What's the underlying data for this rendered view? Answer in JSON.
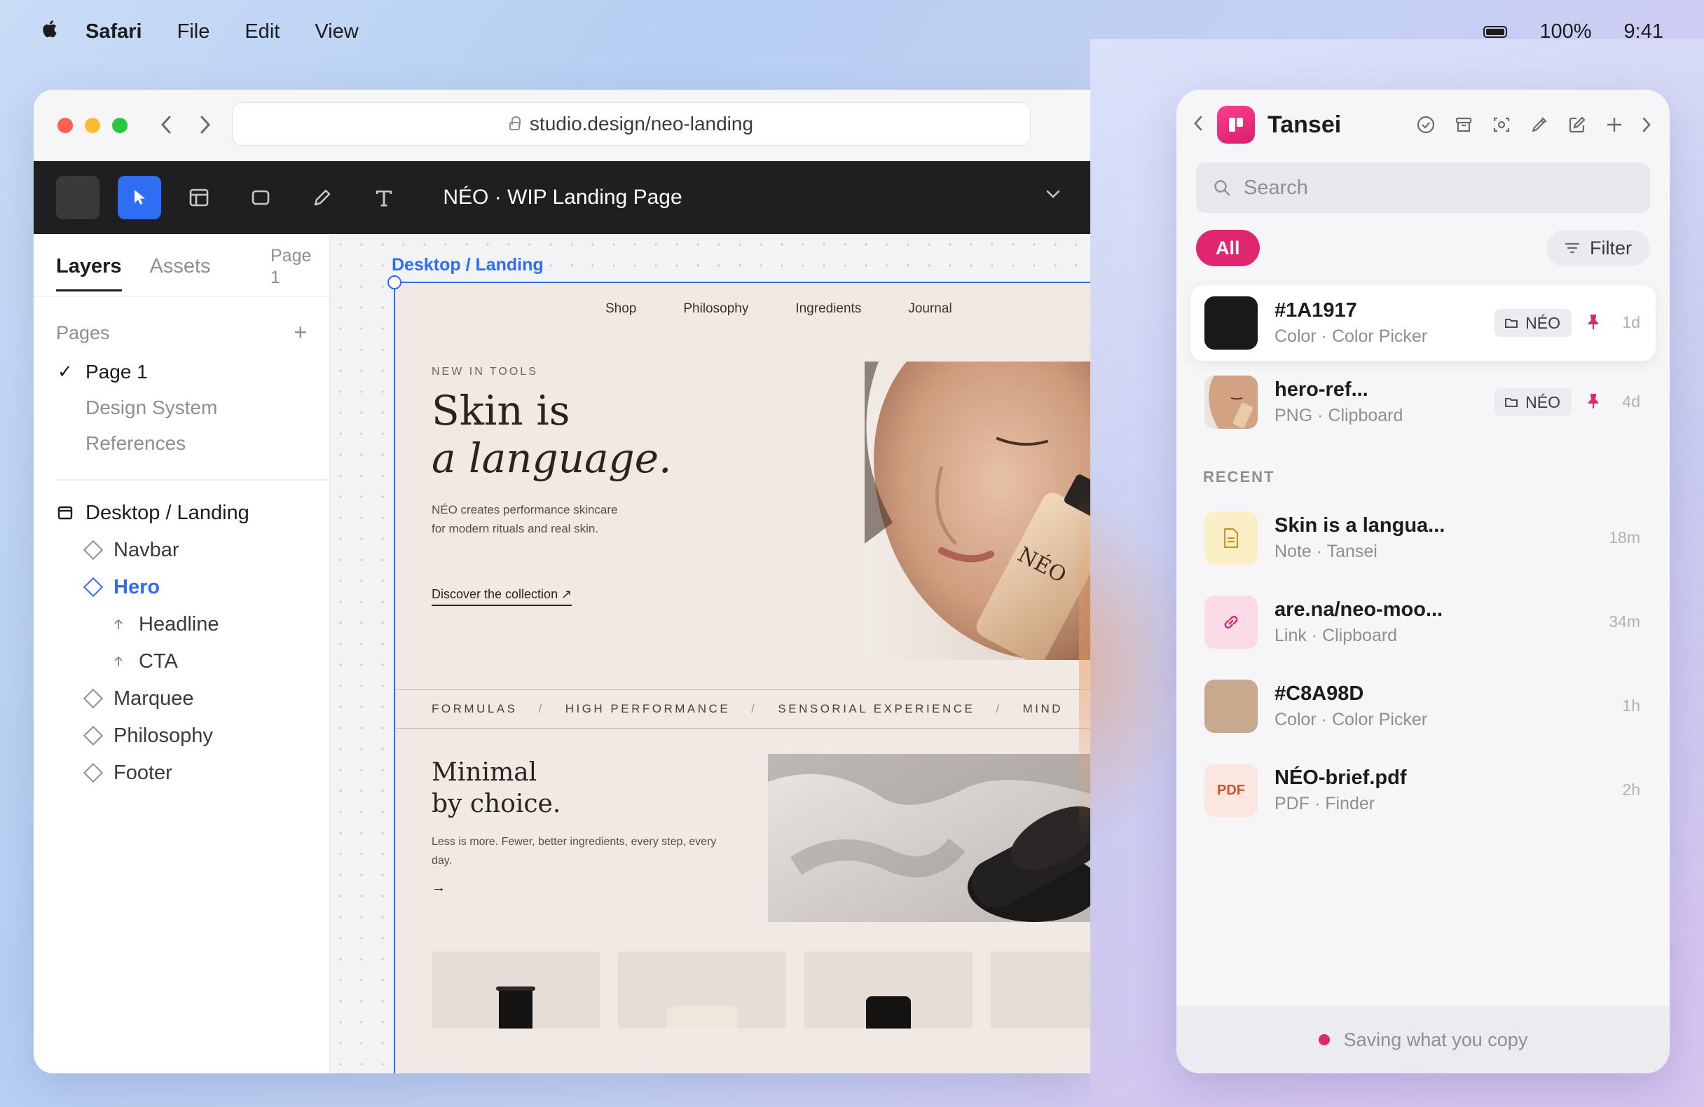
{
  "menubar": {
    "app": "Safari",
    "items": [
      "File",
      "Edit",
      "View"
    ],
    "battery": "100%",
    "time": "9:41"
  },
  "browser": {
    "url": "studio.design/neo-landing"
  },
  "editor": {
    "doc_title": "NÉO · WIP Landing Page",
    "tabs": {
      "layers": "Layers",
      "assets": "Assets",
      "page_indicator": "Page 1"
    },
    "pages_header": "Pages",
    "pages": [
      "Page 1",
      "Design System",
      "References"
    ],
    "frame_name": "Desktop / Landing",
    "layers": [
      "Navbar",
      "Hero",
      "Headline",
      "CTA",
      "Marquee",
      "Philosophy",
      "Footer"
    ]
  },
  "landing": {
    "frame_label": "Desktop / Landing",
    "nav": [
      "Shop",
      "Philosophy",
      "Ingredients",
      "Journal"
    ],
    "eyebrow": "NEW IN TOOLS",
    "headline_1": "Skin is",
    "headline_2": "a language.",
    "body": "NÉO creates performance skincare for modern rituals and real skin.",
    "cta": "Discover the collection ↗",
    "bottle_label": "NÉO",
    "marquee": [
      "FORMULAS",
      "HIGH PERFORMANCE",
      "SENSORIAL EXPERIENCE",
      "MIND"
    ],
    "marquee_sep": "/",
    "minimal_1": "Minimal",
    "minimal_2": "by choice.",
    "minimal_body": "Less is more. Fewer, better ingredients, every step, every day.",
    "arrow": "→"
  },
  "tansei": {
    "title": "Tansei",
    "search_placeholder": "Search",
    "filter_all": "All",
    "filter_btn": "Filter",
    "recent_header": "RECENT",
    "pinned": [
      {
        "title": "#1A1917",
        "sub": "Color · Color Picker",
        "tag": "NÉO",
        "time": "1d",
        "color": "#1A1917"
      },
      {
        "title": "hero-ref...",
        "sub": "PNG · Clipboard",
        "tag": "NÉO",
        "time": "4d"
      }
    ],
    "recent": [
      {
        "title": "Skin is a langua...",
        "sub": "Note · Tansei",
        "time": "18m"
      },
      {
        "title": "are.na/neo-moo...",
        "sub": "Link · Clipboard",
        "time": "34m"
      },
      {
        "title": "#C8A98D",
        "sub": "Color · Color Picker",
        "time": "1h",
        "color": "#C8A98D"
      },
      {
        "title": "NÉO-brief.pdf",
        "sub": "PDF · Finder",
        "time": "2h",
        "badge": "PDF"
      }
    ],
    "footer": "Saving what you copy",
    "accent": "#E0266F"
  }
}
